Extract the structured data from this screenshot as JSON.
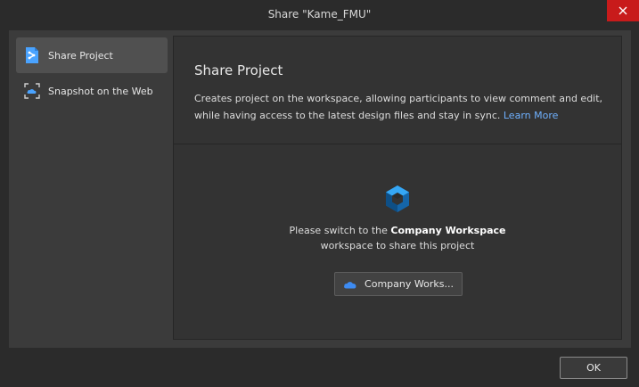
{
  "window": {
    "title": "Share \"Kame_FMU\"",
    "close_icon": "close-icon"
  },
  "sidebar": {
    "items": [
      {
        "label": "Share Project",
        "icon": "share-project-icon",
        "active": true
      },
      {
        "label": "Snapshot on the Web",
        "icon": "snapshot-icon",
        "active": false
      }
    ]
  },
  "panel": {
    "title": "Share Project",
    "description": "Creates project on the workspace, allowing participants to view comment and edit, while having access to the latest design files and stay in sync.",
    "learn_more": "Learn More",
    "switch_prefix": "Please switch to the",
    "switch_workspace_name": "Company Workspace",
    "switch_suffix": "workspace to share this project",
    "workspace_button_label": "Company Works..."
  },
  "footer": {
    "ok_label": "OK"
  },
  "colors": {
    "accent_link": "#6fb1ff",
    "close_red": "#c81b1b",
    "cloud_blue": "#3d8bf2"
  }
}
